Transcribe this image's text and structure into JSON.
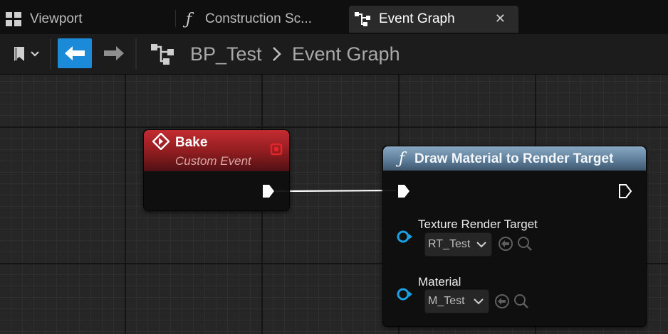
{
  "tabs": [
    {
      "label": "Viewport",
      "icon": "viewport-icon",
      "active": false
    },
    {
      "label": "Construction Sc...",
      "icon": "function-icon",
      "active": false
    },
    {
      "label": "Event Graph",
      "icon": "graph-icon",
      "active": true,
      "close": "✕"
    }
  ],
  "toolbar": {
    "bookmark_icon": "bookmark-icon",
    "back_icon": "back-arrow-icon",
    "forward_icon": "forward-arrow-icon",
    "breadcrumb": [
      "BP_Test",
      "Event Graph"
    ]
  },
  "nodes": {
    "bake": {
      "title": "Bake",
      "subtitle": "Custom Event",
      "header_color": "#b8262b"
    },
    "draw": {
      "title": "Draw Material to Render Target",
      "header_color": "#6f8eaa",
      "pins": [
        {
          "label": "Texture Render Target",
          "value": "RT_Test"
        },
        {
          "label": "Material",
          "value": "M_Test"
        }
      ]
    }
  },
  "colors": {
    "accent": "#1b8ad8",
    "object_pin": "#1aa0e6",
    "exec_pin": "#ffffff",
    "delegate_pin": "#e3242b"
  }
}
